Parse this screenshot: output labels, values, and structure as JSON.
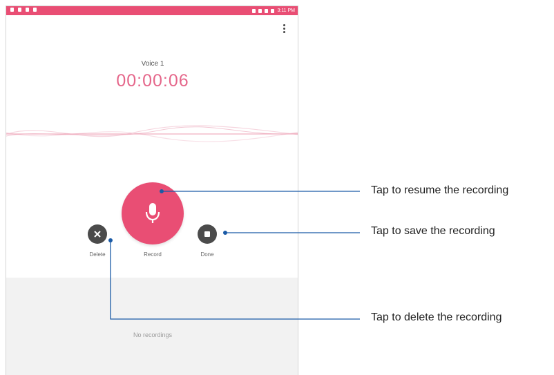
{
  "recorder": {
    "recording_name": "Voice 1",
    "elapsed_time": "00:00:06",
    "delete_label": "Delete",
    "record_label": "Record",
    "done_label": "Done",
    "empty_list_text": "No recordings",
    "status_time": "3:11 PM"
  },
  "callouts": {
    "resume": "Tap to resume the recording",
    "save": "Tap to save the recording",
    "delete": "Tap to delete the recording"
  },
  "icons": {
    "record": "microphone-icon",
    "delete": "close-icon",
    "done": "stop-icon",
    "menu": "overflow-menu-icon"
  },
  "colors": {
    "accent": "#e94e74",
    "timer": "#e5668a",
    "callout_line": "#1a5aa6",
    "side_button": "#4b4b4b",
    "list_background": "#f2f2f2"
  }
}
